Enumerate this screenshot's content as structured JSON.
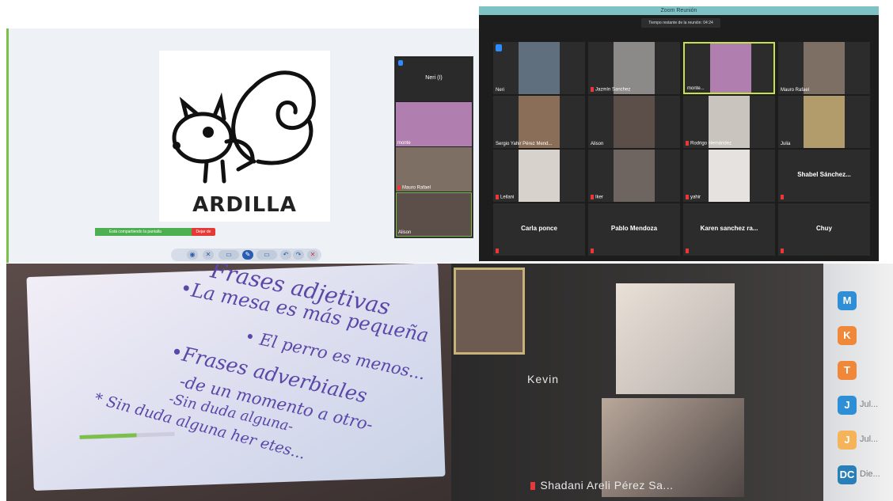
{
  "shared_screen": {
    "drawing_title": "ARDILLA",
    "mini_participants": [
      "Neri (I)",
      "monte",
      "Mauro Rafael",
      "Alison"
    ],
    "share_status_text": "Está compartiendo la pantalla",
    "stop_share_label": "Dejar de"
  },
  "zoom": {
    "window_title": "Zoom Reunión",
    "timer_text": "Tiempo restante de la reunión: 04:24",
    "tiles": [
      {
        "name": "Neri",
        "video": true,
        "color": "#5f6f7d",
        "active": false
      },
      {
        "name": "Jazmín Sanchez",
        "video": true,
        "color": "#8c8a88",
        "active": false
      },
      {
        "name": "monte...",
        "video": true,
        "color": "#b07fb0",
        "active": true
      },
      {
        "name": "Mauro Rafael",
        "video": true,
        "color": "#7d6f63",
        "active": false
      },
      {
        "name": "Sergio Yahir Pérez Mend...",
        "video": true,
        "color": "#8a6e58",
        "active": false
      },
      {
        "name": "Alison",
        "video": true,
        "color": "#5c4e48",
        "active": false
      },
      {
        "name": "Rodrigo Hernández",
        "video": true,
        "color": "#c9c4be",
        "active": false
      },
      {
        "name": "Julia",
        "video": true,
        "color": "#b29c6c",
        "active": false
      },
      {
        "name": "Leilani",
        "video": true,
        "color": "#d8d2cc",
        "active": false
      },
      {
        "name": "Iker",
        "video": true,
        "color": "#6e6460",
        "active": false
      },
      {
        "name": "yahir",
        "video": true,
        "color": "#e6e2df",
        "active": false
      },
      {
        "name": "Shabel  Sánchez...",
        "video": false,
        "active": false
      },
      {
        "name": "Carla ponce",
        "video": false,
        "active": false
      },
      {
        "name": "Pablo Mendoza",
        "video": false,
        "active": false
      },
      {
        "name": "Karen sanchez ra...",
        "video": false,
        "active": false
      },
      {
        "name": "Chuy",
        "video": false,
        "active": false
      }
    ]
  },
  "whiteboard": {
    "lines": [
      "Frases adjetivas",
      "•La mesa es más pequeña",
      "• El perro es menos...",
      "•Frases adverbiales",
      "-de un momento a otro-",
      "-Sin duda alguna-",
      "* Sin duda alguna her etes..."
    ],
    "progress": 0.6
  },
  "laptop": {
    "kevin_label": "Kevin",
    "shadani_label": "Shadani Areli Pérez Sa...",
    "side_avatars": [
      {
        "letter": "M",
        "color": "#2f8fd6",
        "name": ""
      },
      {
        "letter": "K",
        "color": "#f0883a",
        "name": ""
      },
      {
        "letter": "T",
        "color": "#f0883a",
        "name": ""
      },
      {
        "letter": "J",
        "color": "#2f8fd6",
        "name": "Jul..."
      },
      {
        "letter": "J",
        "color": "#f5b35a",
        "name": "Jul..."
      },
      {
        "letter": "DC",
        "color": "#2a7fb8",
        "name": "Die..."
      }
    ]
  }
}
